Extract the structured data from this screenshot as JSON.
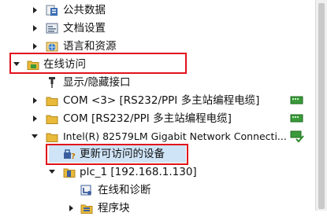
{
  "tree": {
    "items": [
      {
        "label": "公共数据",
        "icon": "common-data-icon"
      },
      {
        "label": "文档设置",
        "icon": "document-settings-icon"
      },
      {
        "label": "语言和资源",
        "icon": "language-resources-icon"
      },
      {
        "label": "在线访问",
        "icon": "folder-online-icon"
      },
      {
        "label": "显示/隐藏接口",
        "icon": "pin-icon"
      },
      {
        "label": "COM <3> [RS232/PPI 多主站编程电缆]",
        "icon": "folder-icon"
      },
      {
        "label": "COM [RS232/PPI 多主站编程电缆]",
        "icon": "folder-icon"
      },
      {
        "label": "Intel(R) 82579LM Gigabit Network Connecti...",
        "icon": "folder-icon"
      },
      {
        "label": "更新可访问的设备",
        "icon": "update-devices-icon"
      },
      {
        "label": "plc_1 [192.168.1.130]",
        "icon": "plc-icon"
      },
      {
        "label": "在线和诊断",
        "icon": "diagnostics-icon"
      },
      {
        "label": "程序块",
        "icon": "program-blocks-icon"
      }
    ]
  },
  "colors": {
    "highlight": "#e0121b",
    "selection": "#cfe4f7",
    "folder": "#e8b93a",
    "status_green": "#3a9a3a"
  }
}
